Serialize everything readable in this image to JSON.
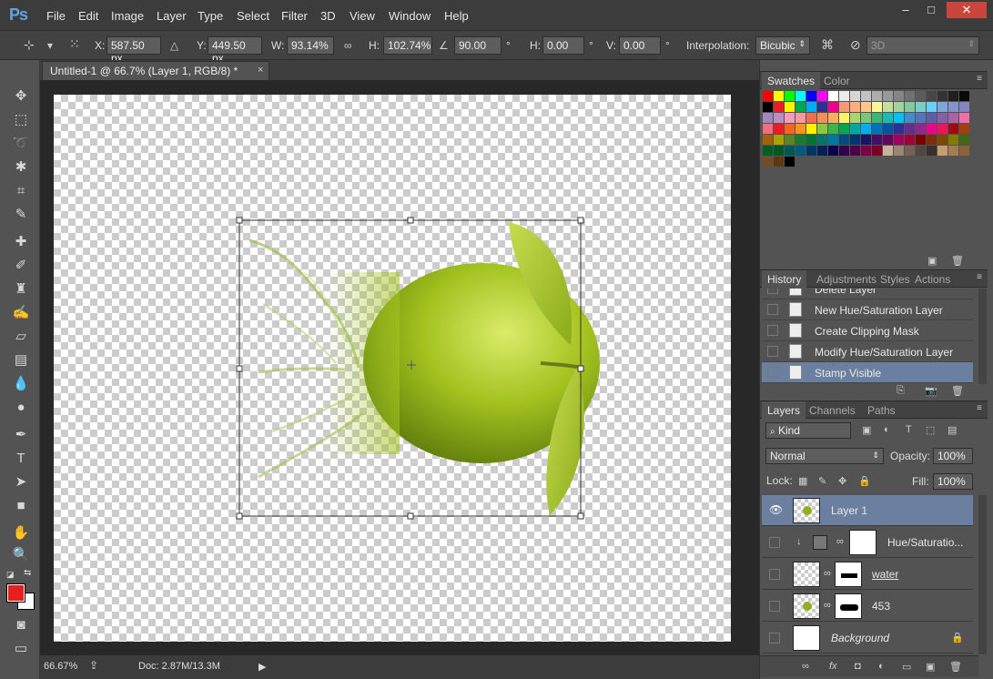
{
  "app": {
    "logo": "Ps"
  },
  "menu": [
    "File",
    "Edit",
    "Image",
    "Layer",
    "Type",
    "Select",
    "Filter",
    "3D",
    "View",
    "Window",
    "Help"
  ],
  "window_controls": {
    "minimize": "–",
    "maximize": "□",
    "close": "✕"
  },
  "options": {
    "x_label": "X:",
    "x_value": "587.50 px",
    "y_label": "Y:",
    "y_value": "449.50 px",
    "w_label": "W:",
    "w_value": "93.14%",
    "h_label": "H:",
    "h_value": "102.74%",
    "angle_value": "90.00",
    "degree": "°",
    "hskew_label": "H:",
    "hskew_value": "0.00",
    "vskew_label": "V:",
    "vskew_value": "0.00",
    "interp_label": "Interpolation:",
    "interp_value": "Bicubic",
    "mode_3d": "3D"
  },
  "document": {
    "tab_title": "Untitled-1 @ 66.7% (Layer 1, RGB/8) *",
    "tab_close": "×",
    "zoom": "66.67%",
    "doc_size": "Doc: 2.87M/13.3M"
  },
  "swatches_panel": {
    "tabs": [
      "Swatches",
      "Color"
    ],
    "colors": [
      "#ff0000",
      "#ffff00",
      "#00ff00",
      "#00ffff",
      "#0000ff",
      "#ff00ff",
      "#ffffff",
      "#ebebeb",
      "#d6d6d6",
      "#c2c2c2",
      "#adadad",
      "#999999",
      "#858585",
      "#707070",
      "#5c5c5c",
      "#474747",
      "#333333",
      "#1f1f1f",
      "#0a0a0a",
      "#000000",
      "#ed1c24",
      "#fff200",
      "#00a651",
      "#00aeef",
      "#2e3192",
      "#ec008c",
      "#f7977a",
      "#f9ad81",
      "#fdc68a",
      "#fff79a",
      "#c4df9b",
      "#a3d39c",
      "#82ca9d",
      "#7bcdc8",
      "#6ecff6",
      "#7ea7d8",
      "#8493ca",
      "#8882be",
      "#a187be",
      "#bc8dbf",
      "#f49ac2",
      "#f6989d",
      "#f26c4f",
      "#f68e55",
      "#fbaf5c",
      "#fff467",
      "#acd372",
      "#7cc576",
      "#3bb878",
      "#1abbb4",
      "#00bff3",
      "#438ccb",
      "#5574b9",
      "#605ca8",
      "#855fa8",
      "#a763a8",
      "#f06eaa",
      "#f26d7d",
      "#ed1c24",
      "#f26522",
      "#f7941d",
      "#fff200",
      "#8dc73f",
      "#39b54a",
      "#00a651",
      "#00a99d",
      "#00aeef",
      "#0072bc",
      "#0054a6",
      "#2e3192",
      "#662d91",
      "#92278f",
      "#ec008c",
      "#ed145b",
      "#9e0b0f",
      "#a0410d",
      "#a36209",
      "#aba000",
      "#598527",
      "#197b30",
      "#007236",
      "#00746b",
      "#0076a3",
      "#004b80",
      "#003471",
      "#1b1464",
      "#440e62",
      "#630460",
      "#9e005d",
      "#9e0039",
      "#790000",
      "#7b2e00",
      "#7d4900",
      "#827b00",
      "#406618",
      "#005e20",
      "#005826",
      "#005952",
      "#005b7f",
      "#003663",
      "#002157",
      "#0d004c",
      "#32004b",
      "#4b0049",
      "#7b0046",
      "#7a0026",
      "#c7b299",
      "#998675",
      "#736357",
      "#534741",
      "#37302d",
      "#c69c6d",
      "#a67c52",
      "#8c6239",
      "#754c24",
      "#603913",
      "#000000"
    ]
  },
  "history_panel": {
    "tabs": [
      "History",
      "Adjustments",
      "Styles",
      "Actions"
    ],
    "items": [
      "Delete Layer",
      "New Hue/Saturation Layer",
      "Create Clipping Mask",
      "Modify Hue/Saturation Layer",
      "Stamp Visible"
    ]
  },
  "layers_panel": {
    "tabs": [
      "Layers",
      "Channels",
      "Paths"
    ],
    "filter": "Kind",
    "blend_mode": "Normal",
    "opacity_label": "Opacity:",
    "opacity_value": "100%",
    "lock_label": "Lock:",
    "fill_label": "Fill:",
    "fill_value": "100%",
    "layers": [
      "Layer 1",
      "Hue/Saturatio...",
      "water",
      "453",
      "Background"
    ]
  }
}
